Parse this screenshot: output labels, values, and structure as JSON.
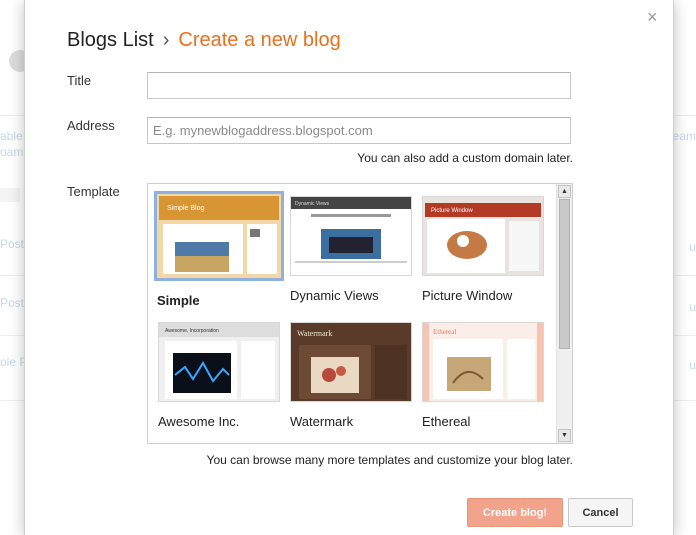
{
  "background_page": {
    "fragments_left": [
      "able",
      "oam",
      "Post",
      "Post",
      "ole P"
    ],
    "fragments_right": [
      "eam",
      "u",
      "u",
      "u"
    ]
  },
  "dialog": {
    "breadcrumb": {
      "root": "Blogs List",
      "separator": "›",
      "current": "Create a new blog"
    },
    "title_label": "Title",
    "title_value": "",
    "address_label": "Address",
    "address_placeholder": "E.g. mynewblogaddress.blogspot.com",
    "address_hint": "You can also add a custom domain later.",
    "template_label": "Template",
    "templates": [
      {
        "name": "Simple",
        "selected": true
      },
      {
        "name": "Dynamic Views",
        "selected": false
      },
      {
        "name": "Picture Window",
        "selected": false
      },
      {
        "name": "Awesome Inc.",
        "selected": false
      },
      {
        "name": "Watermark",
        "selected": false
      },
      {
        "name": "Ethereal",
        "selected": false
      }
    ],
    "thumb_captions": {
      "simple": "Simple Blog",
      "dynamic": "Dynamic Views",
      "picture": "Picture Window",
      "awesome": "Awesome, Incorporation",
      "watermark": "Watermark",
      "ethereal": "Ethereal"
    },
    "template_hint": "You can browse many more templates and customize your blog later.",
    "create_button": "Create blog!",
    "cancel_button": "Cancel",
    "close_icon": "×"
  },
  "colors": {
    "accent": "#e8711e",
    "primary_button": "#f2a38b",
    "selection_border": "#8eb1e0"
  }
}
